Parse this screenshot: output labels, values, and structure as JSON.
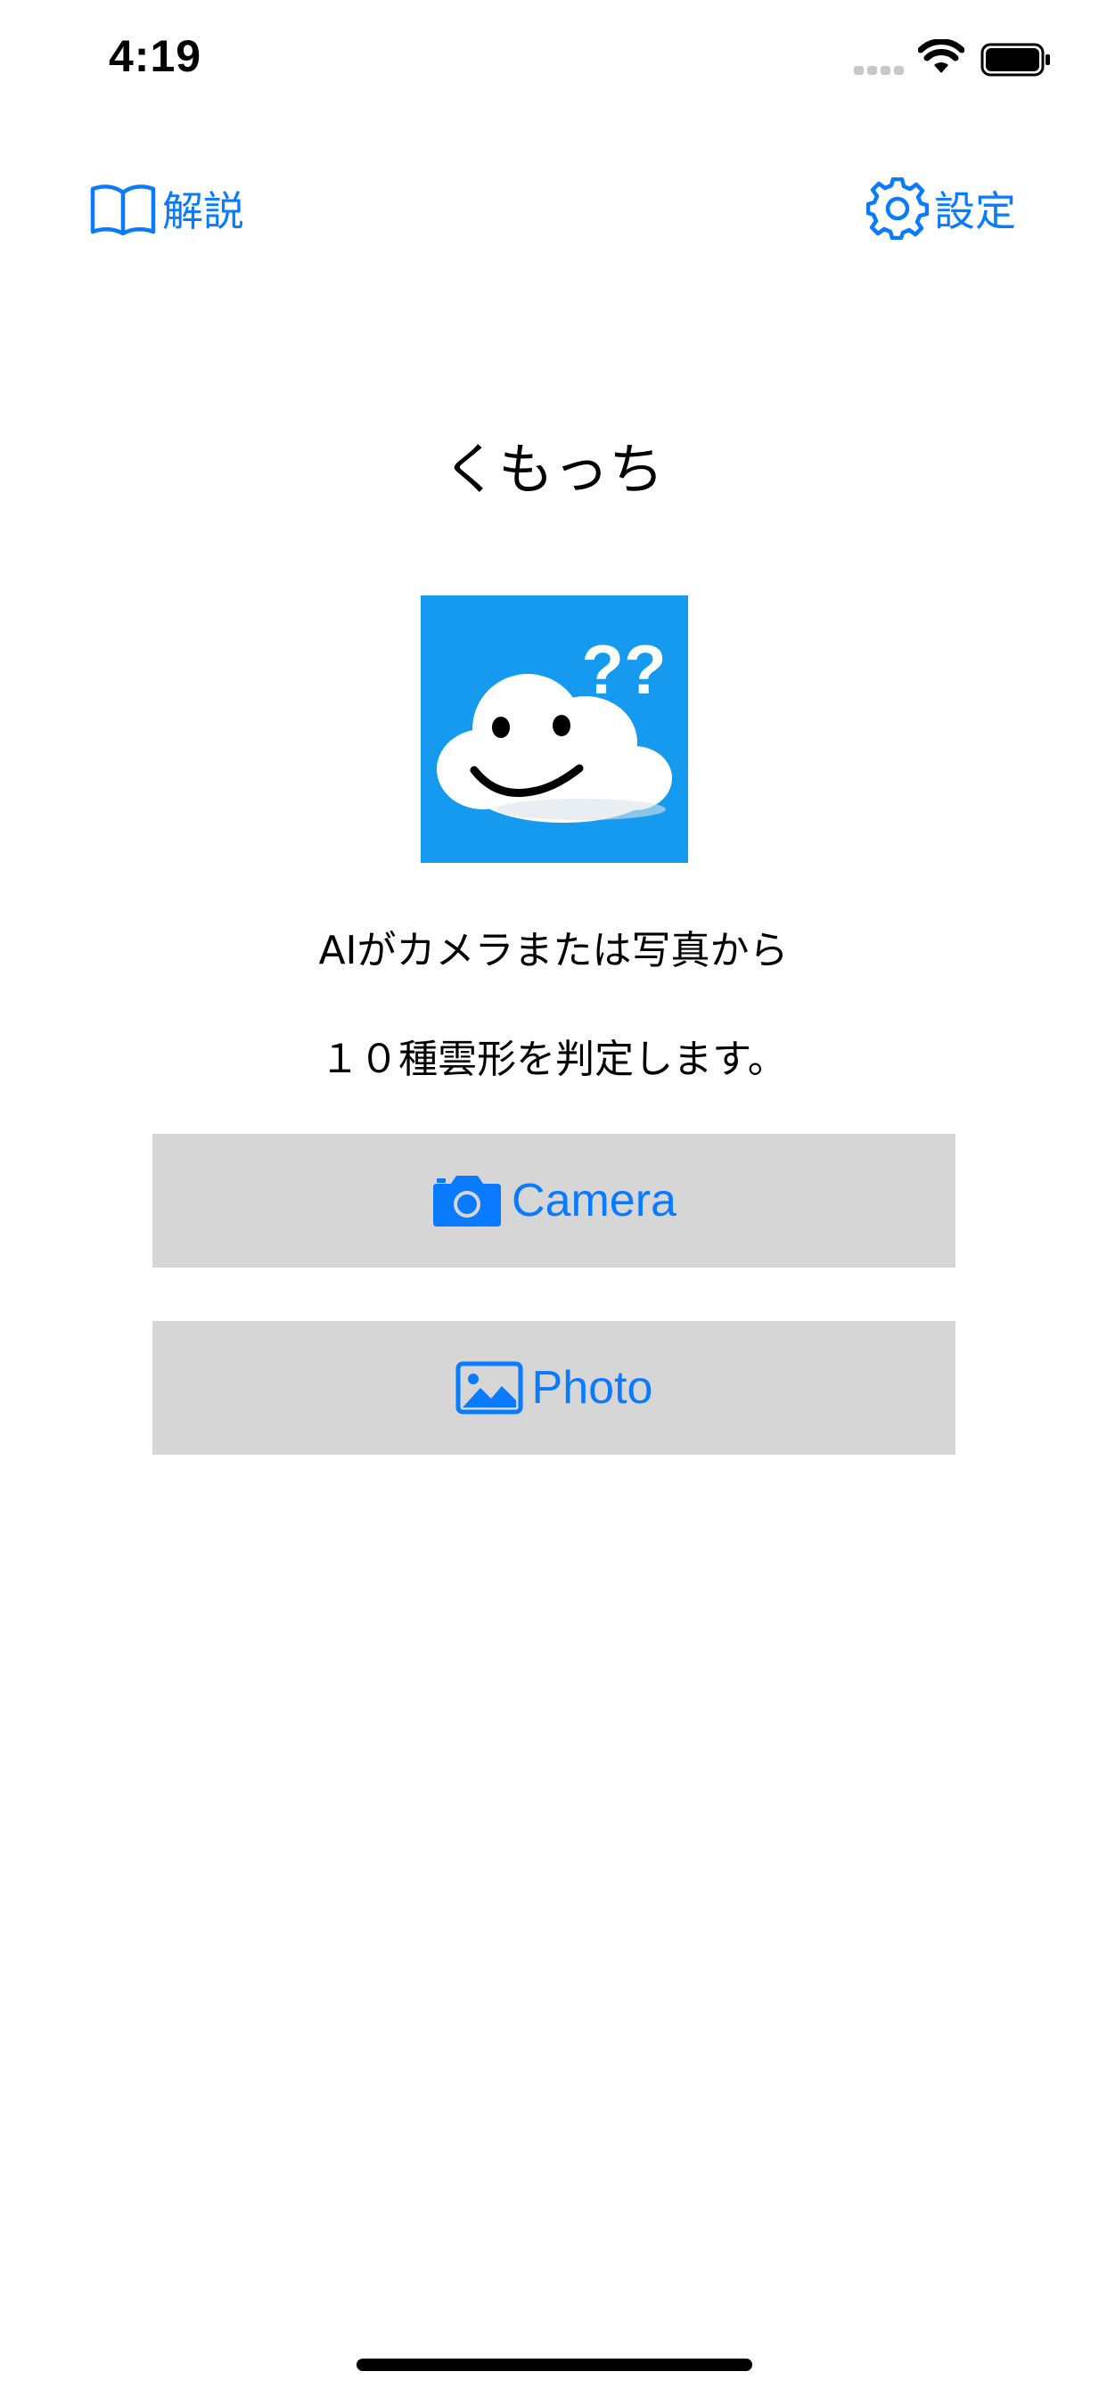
{
  "status_bar": {
    "time": "4:19"
  },
  "nav": {
    "left_label": "解説",
    "left_icon": "book-icon",
    "right_label": "設定",
    "right_icon": "gear-icon"
  },
  "title": "くもっち",
  "app_image": {
    "question_marks": "??"
  },
  "description": {
    "line1": "AIがカメラまたは写真から",
    "line2": "１０種雲形を判定します。"
  },
  "buttons": {
    "camera_label": "Camera",
    "camera_icon": "camera-icon",
    "photo_label": "Photo",
    "photo_icon": "photo-icon"
  },
  "colors": {
    "accent": "#0a7aff",
    "button_bg": "#d6d6d6",
    "image_bg": "#159af0"
  }
}
